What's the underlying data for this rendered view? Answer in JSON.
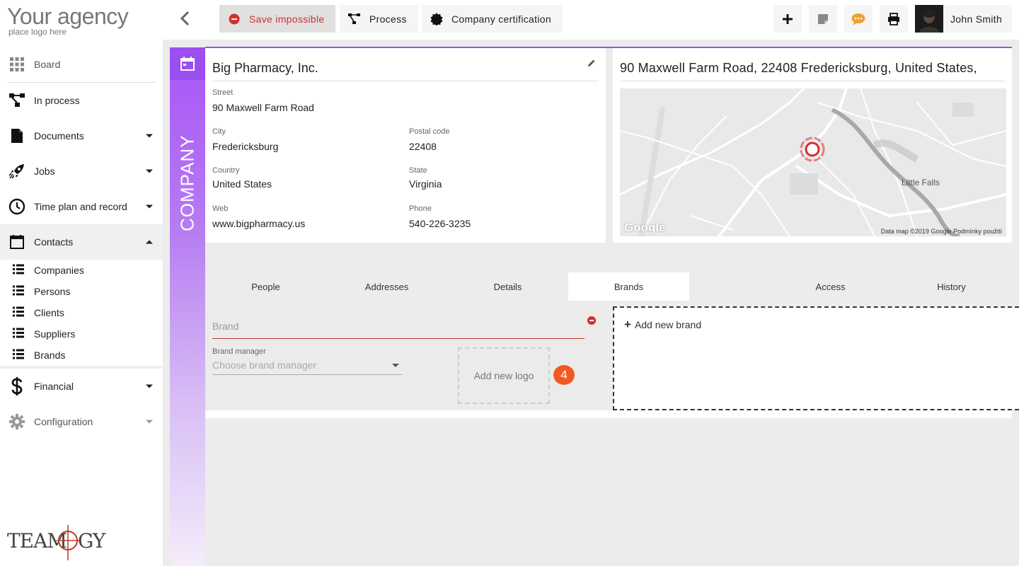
{
  "app": {
    "logo_big": "Your agency",
    "logo_small": "place logo here",
    "footer_brand": "TEAMOGY"
  },
  "sidebar": {
    "items": [
      {
        "label": "Board",
        "icon": "grid-icon"
      },
      {
        "label": "In process",
        "icon": "process-icon"
      },
      {
        "label": "Documents",
        "icon": "document-icon"
      },
      {
        "label": "Jobs",
        "icon": "rocket-icon"
      },
      {
        "label": "Time plan and record",
        "icon": "clock-icon"
      },
      {
        "label": "Contacts",
        "icon": "calendar-icon"
      },
      {
        "label": "Financial",
        "icon": "dollar-icon"
      },
      {
        "label": "Configuration",
        "icon": "gear-icon"
      }
    ],
    "contacts_sub": [
      "Companies",
      "Persons",
      "Clients",
      "Suppliers",
      "Brands"
    ]
  },
  "toolbar": {
    "save_label": "Save impossible",
    "process_label": "Process",
    "certification_label": "Company certification",
    "user_name": "John Smith",
    "save_color": "#d32f2f",
    "chat_color": "#f0a030"
  },
  "entity": {
    "type_label": "COMPANY",
    "accent": "#9b4ff0"
  },
  "company": {
    "name": "Big Pharmacy, Inc.",
    "street_label": "Street",
    "street": "90  Maxwell Farm Road",
    "city_label": "City",
    "city": "Fredericksburg",
    "postal_label": "Postal code",
    "postal": "22408",
    "country_label": "Country",
    "country": "United States",
    "state_label": "State",
    "state": "Virginia",
    "web_label": "Web",
    "web": "www.bigpharmacy.us",
    "phone_label": "Phone",
    "phone": "540-226-3235"
  },
  "map": {
    "address": "90 Maxwell Farm Road, 22408 Fredericksburg, United States,",
    "town": "Little Falls",
    "attribution": "Data map ©2019 Google    Podmínky použití",
    "google": "Google"
  },
  "tabs": [
    "People",
    "Addresses",
    "Details",
    "Brands",
    "",
    "Access",
    "History"
  ],
  "active_tab": "Brands",
  "brand_form": {
    "brand_placeholder": "Brand",
    "manager_label": "Brand manager",
    "manager_placeholder": "Choose brand manager",
    "add_logo": "Add new logo",
    "badge_count": "4",
    "add_brand": "Add new brand"
  }
}
